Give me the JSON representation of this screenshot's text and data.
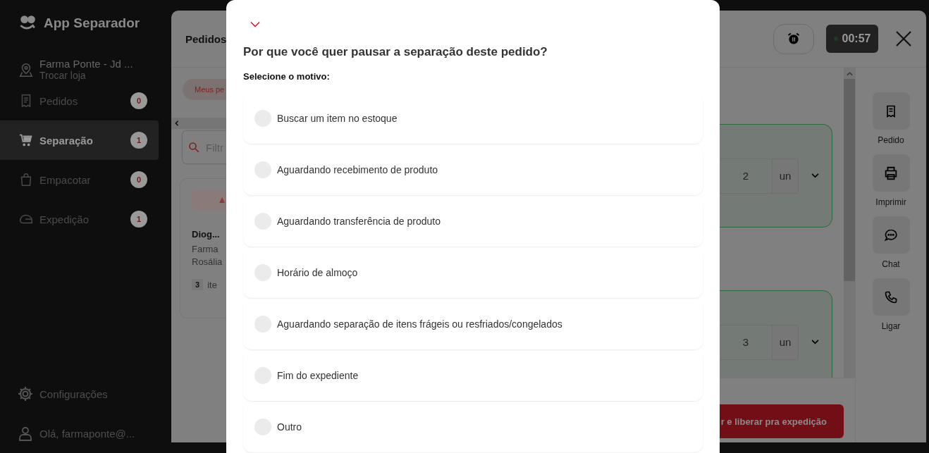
{
  "sidebar": {
    "app_title": "App Separador",
    "store": {
      "name": "Farma Ponte - Jd ...",
      "action": "Trocar loja"
    },
    "nav": [
      {
        "label": "Pedidos",
        "count": "0",
        "selected": false,
        "kind": "receipt"
      },
      {
        "label": "Separação",
        "count": "1",
        "selected": true,
        "kind": "cart"
      },
      {
        "label": "Empacotar",
        "count": "0",
        "selected": false,
        "kind": "bag"
      },
      {
        "label": "Expedição",
        "count": "1",
        "selected": false,
        "kind": "helmet"
      }
    ],
    "settings": "Configurações",
    "user": "Olá, farmaponte@..."
  },
  "orders_panel": {
    "title": "Pedidos",
    "filter_chip": "Meus pe",
    "search_placeholder": "Filtr",
    "order_card": {
      "customer": "Diog...",
      "line_1": "Farma",
      "line_2": "Rosália",
      "item_count": "3",
      "item_label": "ite"
    }
  },
  "order_header": {
    "timer": "00:57"
  },
  "items": [
    {
      "quantity": "2",
      "unit": "un"
    },
    {
      "quantity": "3",
      "unit": "un"
    }
  ],
  "finish_button": "r e liberar pra expedição",
  "actions": [
    {
      "label": "Pedido",
      "kind": "receipt"
    },
    {
      "label": "Imprimir",
      "kind": "printer"
    },
    {
      "label": "Chat",
      "kind": "chat"
    },
    {
      "label": "Ligar",
      "kind": "phone"
    }
  ],
  "pause_dialog": {
    "question": "Por que você quer pausar a separação deste pedido?",
    "prompt": "Selecione o motivo:",
    "reasons": [
      {
        "label": "Buscar um item no estoque",
        "selected": false
      },
      {
        "label": "Aguardando recebimento de produto",
        "selected": false
      },
      {
        "label": "Aguardando transferência de produto",
        "selected": false
      },
      {
        "label": "Horário de almoço",
        "selected": false
      },
      {
        "label": "Aguardando separação de itens frágeis ou resfriados/congelados",
        "selected": false
      },
      {
        "label": "Fim do expediente",
        "selected": false
      },
      {
        "label": "Outro",
        "selected": false
      }
    ]
  }
}
